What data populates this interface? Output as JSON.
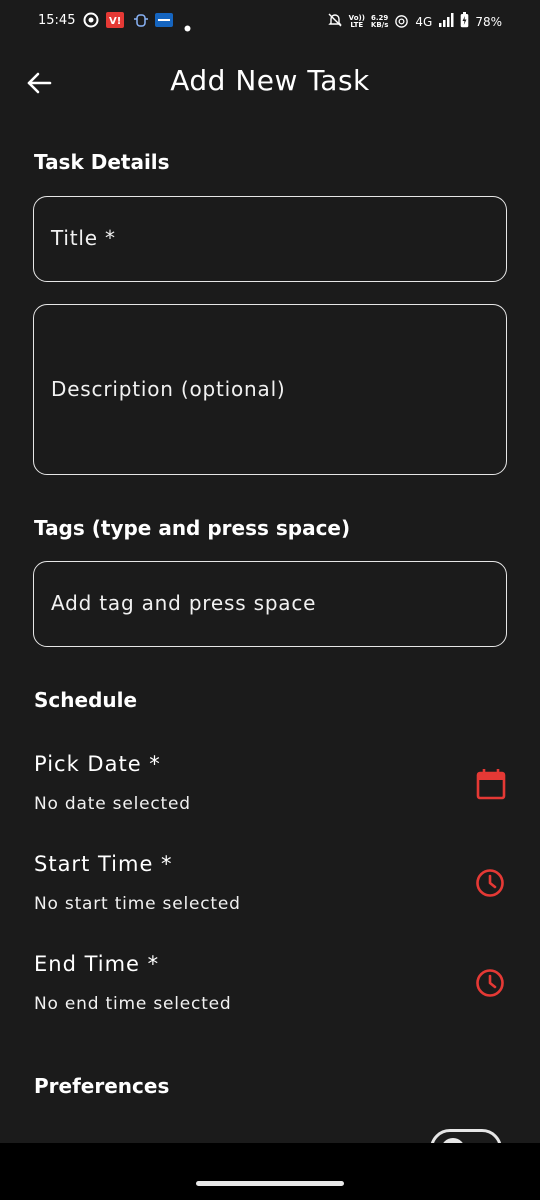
{
  "status_bar": {
    "time": "15:45",
    "net_top": "Vo))",
    "net_bottom": "LTE",
    "speed_top": "6.29",
    "speed_bottom": "KB/s",
    "network": "4G",
    "battery": "78%"
  },
  "header": {
    "title": "Add New Task"
  },
  "task_details": {
    "section_title": "Task Details",
    "title_placeholder": "Title *",
    "description_placeholder": "Description (optional)"
  },
  "tags": {
    "section_title": "Tags (type and press space)",
    "placeholder": "Add tag and press space"
  },
  "schedule": {
    "section_title": "Schedule",
    "date": {
      "label": "Pick Date *",
      "value": "No date selected",
      "icon": "calendar-icon"
    },
    "start": {
      "label": "Start Time *",
      "value": "No start time selected",
      "icon": "clock-icon"
    },
    "end": {
      "label": "End Time *",
      "value": "No end time selected",
      "icon": "clock-icon"
    }
  },
  "preferences": {
    "section_title": "Preferences"
  },
  "colors": {
    "background": "#1b1b1b",
    "accent": "#e53935",
    "border": "#e6e6e6"
  }
}
